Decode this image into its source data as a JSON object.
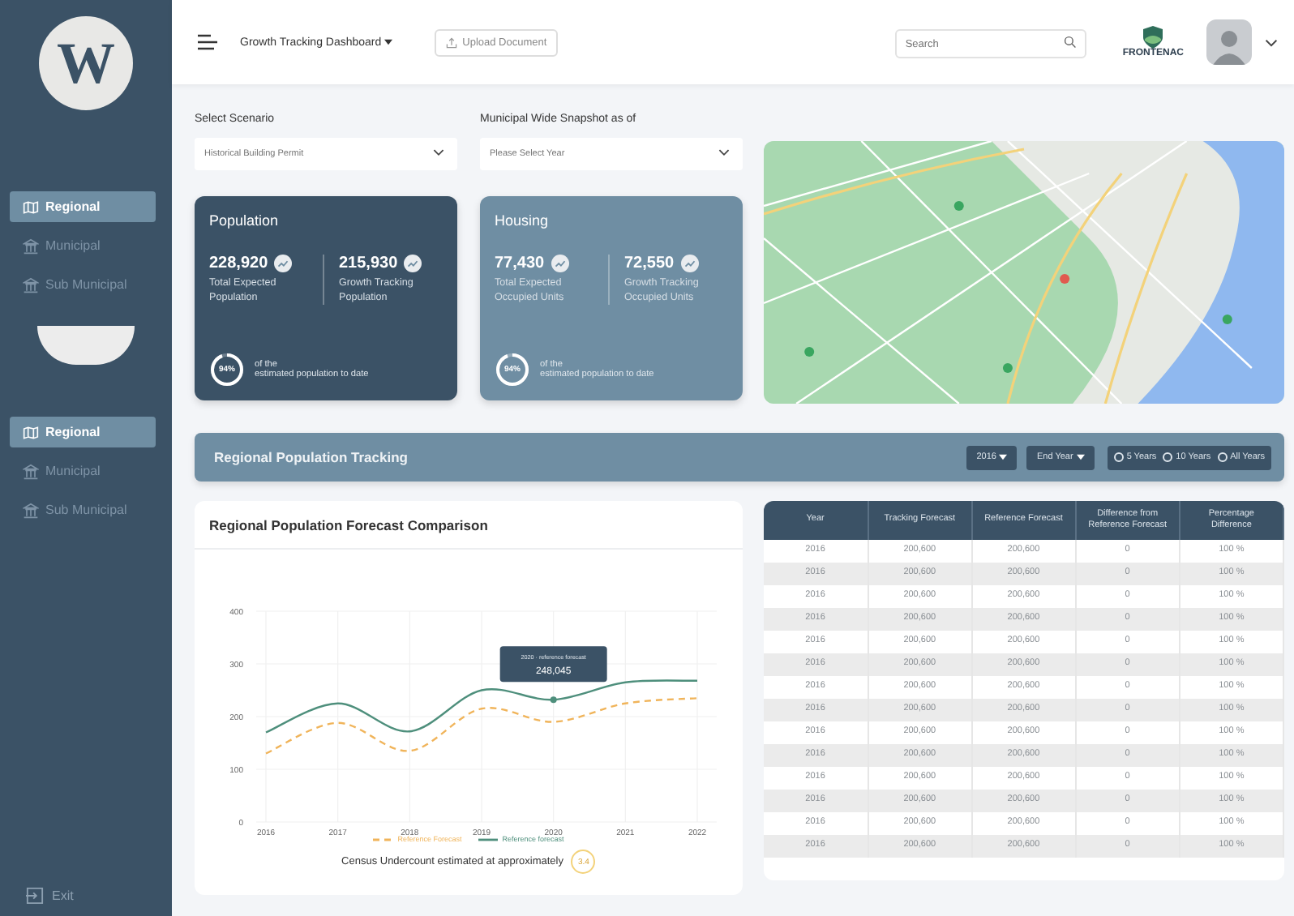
{
  "sidebar": {
    "logo": "W",
    "nav_groups": [
      [
        {
          "label": "Regional",
          "selected": true
        },
        {
          "label": "Municipal",
          "selected": false
        },
        {
          "label": "Sub Municipal",
          "selected": false
        }
      ],
      [
        {
          "label": "Regional",
          "selected": true
        },
        {
          "label": "Municipal",
          "selected": false
        },
        {
          "label": "Sub Municipal",
          "selected": false
        }
      ]
    ],
    "exit": "Exit"
  },
  "header": {
    "title": "Growth Tracking Dashboard",
    "upload_button": "Upload Document",
    "search": {
      "placeholder": "Search"
    },
    "org_name": "FRONTENAC"
  },
  "filters": [
    {
      "label": "Select Scenario",
      "placeholder": "Historical Building Permit"
    },
    {
      "label": "Municipal Wide Snapshot as of",
      "placeholder": "Please Select Year"
    }
  ],
  "cards": [
    {
      "title": "Population",
      "kind": "dark",
      "stats": [
        {
          "value": "228,920",
          "label": "Total Expected Population"
        },
        {
          "value": "215,930",
          "label": "Growth Tracking Population"
        }
      ],
      "progress": {
        "text": "94%",
        "level": 0.94,
        "caption_1": "of the",
        "caption_2": "estimated population to date"
      }
    },
    {
      "title": "Housing",
      "kind": "light",
      "stats": [
        {
          "value": "77,430",
          "label": "Total Expected Occupied Units"
        },
        {
          "value": "72,550",
          "label": "Growth Tracking Occupied Units"
        }
      ],
      "progress": {
        "text": "94%",
        "level": 0.94,
        "caption_1": "of the",
        "caption_2": "estimated population to date"
      }
    }
  ],
  "tracking": {
    "title": "Regional Population Tracking",
    "start_year": "2016",
    "end_year": "End Year",
    "ranges": [
      {
        "label": "5 Years",
        "selected": false
      },
      {
        "label": "10 Years",
        "selected": false
      },
      {
        "label": "All Years",
        "selected": false
      }
    ]
  },
  "chart": {
    "title": "Regional Population Forecast Comparison",
    "chart_data": {
      "type": "line",
      "categories": [
        "2016",
        "2017",
        "2018",
        "2019",
        "2020",
        "2021",
        "2022"
      ],
      "ylim": [
        0,
        400
      ],
      "grid": true,
      "yticks": [
        0,
        100,
        200,
        300,
        400
      ],
      "series": [
        {
          "name": "Reference Forecast",
          "color": "#f0b45a",
          "line_style": "dashed",
          "values": [
            130,
            188,
            135,
            215,
            190,
            225,
            235
          ]
        },
        {
          "name": "Reference forecast",
          "color": "#4e8f7c",
          "line_style": "solid",
          "values": [
            170,
            225,
            172,
            250,
            232,
            265,
            268
          ]
        }
      ]
    },
    "tooltip": {
      "title": "2020 · reference forecast",
      "value": "248,045"
    },
    "note": "Census Undercount estimated at approximately",
    "note_value": "3.4"
  },
  "table": {
    "columns": [
      "Year",
      "Tracking Forecast",
      "Reference Forecast",
      "Difference from Reference Forecast",
      "Percentage Difference"
    ],
    "rows": [
      [
        "2016",
        "200,600",
        "200,600",
        "0",
        "100 %"
      ],
      [
        "2016",
        "200,600",
        "200,600",
        "0",
        "100 %"
      ],
      [
        "2016",
        "200,600",
        "200,600",
        "0",
        "100 %"
      ],
      [
        "2016",
        "200,600",
        "200,600",
        "0",
        "100 %"
      ],
      [
        "2016",
        "200,600",
        "200,600",
        "0",
        "100 %"
      ],
      [
        "2016",
        "200,600",
        "200,600",
        "0",
        "100 %"
      ],
      [
        "2016",
        "200,600",
        "200,600",
        "0",
        "100 %"
      ],
      [
        "2016",
        "200,600",
        "200,600",
        "0",
        "100 %"
      ],
      [
        "2016",
        "200,600",
        "200,600",
        "0",
        "100 %"
      ],
      [
        "2016",
        "200,600",
        "200,600",
        "0",
        "100 %"
      ],
      [
        "2016",
        "200,600",
        "200,600",
        "0",
        "100 %"
      ],
      [
        "2016",
        "200,600",
        "200,600",
        "0",
        "100 %"
      ],
      [
        "2016",
        "200,600",
        "200,600",
        "0",
        "100 %"
      ],
      [
        "2016",
        "200,600",
        "200,600",
        "0",
        "100 %"
      ]
    ]
  }
}
